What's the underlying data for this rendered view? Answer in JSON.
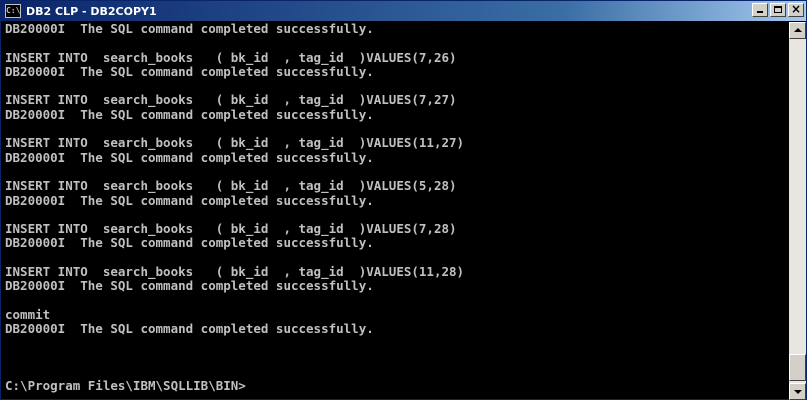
{
  "window": {
    "title": "DB2 CLP - DB2COPY1",
    "icon_label": "C:\\"
  },
  "console": {
    "lines": [
      "DB20000I  The SQL command completed successfully.",
      "",
      "INSERT INTO  search_books   ( bk_id  , tag_id  )VALUES(7,26)",
      "DB20000I  The SQL command completed successfully.",
      "",
      "INSERT INTO  search_books   ( bk_id  , tag_id  )VALUES(7,27)",
      "DB20000I  The SQL command completed successfully.",
      "",
      "INSERT INTO  search_books   ( bk_id  , tag_id  )VALUES(11,27)",
      "DB20000I  The SQL command completed successfully.",
      "",
      "INSERT INTO  search_books   ( bk_id  , tag_id  )VALUES(5,28)",
      "DB20000I  The SQL command completed successfully.",
      "",
      "INSERT INTO  search_books   ( bk_id  , tag_id  )VALUES(7,28)",
      "DB20000I  The SQL command completed successfully.",
      "",
      "INSERT INTO  search_books   ( bk_id  , tag_id  )VALUES(11,28)",
      "DB20000I  The SQL command completed successfully.",
      "",
      "commit",
      "DB20000I  The SQL command completed successfully.",
      "",
      "",
      "",
      "C:\\Program Files\\IBM\\SQLLIB\\BIN>"
    ]
  },
  "colors": {
    "titlebar_start": "#0a246a",
    "titlebar_end": "#a6caf0",
    "console_bg": "#000000",
    "console_fg": "#c0c0c0"
  },
  "icons": {
    "app": "console-icon",
    "minimize": "minimize-icon",
    "maximize": "maximize-icon",
    "close": "close-icon"
  }
}
